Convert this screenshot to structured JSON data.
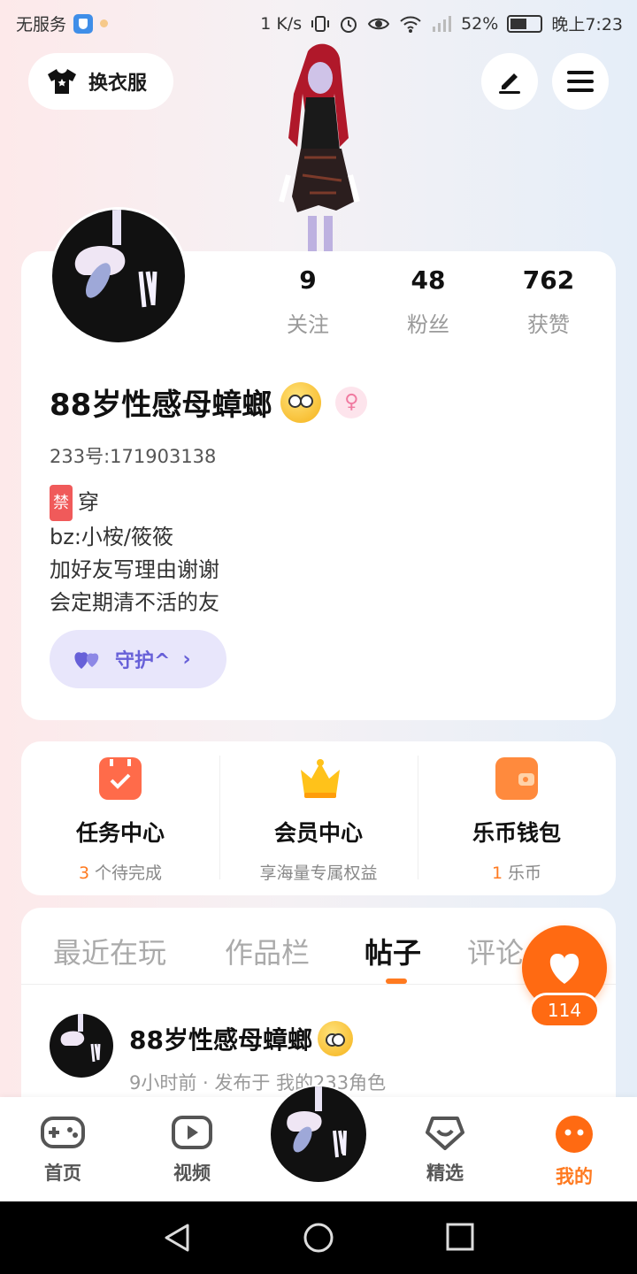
{
  "status_bar": {
    "left_text": "无服务",
    "speed": "1 K/s",
    "battery": "52%",
    "time": "晚上7:23"
  },
  "top_bar": {
    "dress_label": "换衣服"
  },
  "profile": {
    "stats": [
      {
        "value": "9",
        "label": "关注"
      },
      {
        "value": "48",
        "label": "粉丝"
      },
      {
        "value": "762",
        "label": "获赞"
      }
    ],
    "username": "88岁性感母蟑螂",
    "uid": "233号:171903138",
    "bio_tag": "禁",
    "bio_lines": [
      "穿",
      "bz:小桉/筱筱",
      "加好友写理由谢谢",
      "会定期清不活的友"
    ],
    "guard_label": "守护^",
    "guard_chevron": "›"
  },
  "features": [
    {
      "title": "任务中心",
      "count": "3",
      "subtitle": "个待完成"
    },
    {
      "title": "会员中心",
      "count": "",
      "subtitle": "享海量专属权益"
    },
    {
      "title": "乐币钱包",
      "count": "1",
      "subtitle": "乐币"
    }
  ],
  "tabs": [
    "最近在玩",
    "作品栏",
    "帖子",
    "评论"
  ],
  "active_tab": "帖子",
  "post": {
    "author": "88岁性感母蟑螂",
    "meta": "9小时前 · 发布于 我的233角色"
  },
  "like_fab": {
    "count": "114"
  },
  "bottom_nav": [
    {
      "label": "首页"
    },
    {
      "label": "视频"
    },
    {
      "label": "精选"
    },
    {
      "label": "我的"
    }
  ],
  "colors": {
    "accent": "#ff7a20",
    "guard_purple": "#6760d8",
    "female_pink": "#f07aa0"
  }
}
